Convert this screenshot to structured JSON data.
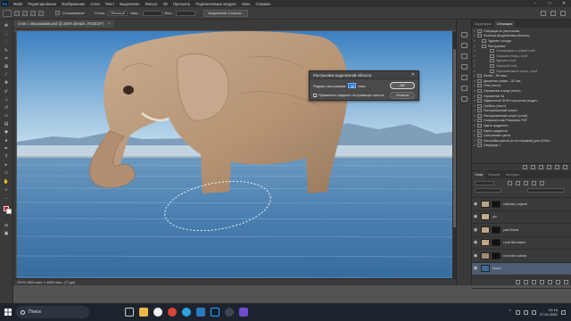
{
  "menubar": {
    "logo": "Ps",
    "items": [
      "Файл",
      "Редактирование",
      "Изображение",
      "Слои",
      "Текст",
      "Выделение",
      "Фильтр",
      "3D",
      "Просмотр",
      "Подключаемые модули",
      "Окно",
      "Справка"
    ],
    "window_controls": [
      "–",
      "□",
      "✕"
    ]
  },
  "options": {
    "smooth_label": "Сглаживание",
    "style_label": "Стиль:",
    "style_value": "Обычный",
    "width_label": "Шир.:",
    "height_label": "Выс.:",
    "refine_button": "Выделение и маска..."
  },
  "document": {
    "tab_title": "слон с пёрышками.psd @ 200% (beach, RGB/16*)",
    "tab_close": "×"
  },
  "status": {
    "text": "200%  1800 пикс. x 4656 пикс. (72 ppi)"
  },
  "dialog": {
    "title": "Растушевка выделенной области",
    "close": "✕",
    "radius_label": "Радиус растушевки:",
    "radius_value": "30",
    "unit": "пикс.",
    "checkbox_label": "Применить эффект на границах холста",
    "ok": "OK",
    "cancel": "Отмена"
  },
  "panels": {
    "top_tabs": [
      "Коррекция",
      "Операции"
    ],
    "history_items": [
      {
        "label": "Операции по умолчанию",
        "level": 0
      },
      {
        "label": "Фильтры (выделенная область)",
        "level": 0
      },
      {
        "label": "Удалить соседи",
        "level": 1
      },
      {
        "label": "Растушевка",
        "level": 1
      },
      {
        "label": "Скопировать в новый слой",
        "level": 2
      },
      {
        "label": "Показать текущ. слой",
        "level": 2
      },
      {
        "label": "Удалить слой",
        "level": 2
      },
      {
        "label": "Скрытый слой",
        "level": 2
      },
      {
        "label": "Переименовать текущ. слой",
        "level": 2
      },
      {
        "label": "Линия – 50 пикс.",
        "level": 0
      },
      {
        "label": "Движение рамки – 50 пик...",
        "level": 0
      },
      {
        "label": "Тень (текст)",
        "level": 0
      },
      {
        "label": "Отражение в воде (текст)",
        "level": 0
      },
      {
        "label": "Отражение 3d",
        "level": 0
      },
      {
        "label": "Эффектный ЭНФ в прошлом (выдел...",
        "level": 0
      },
      {
        "label": "Гребень (текст)",
        "level": 0
      },
      {
        "label": "Растушеванный силуэт",
        "level": 0
      },
      {
        "label": "Растушеванный силуэт (слой)",
        "level": 0
      },
      {
        "label": "Сохранить как Photoshop PDF",
        "level": 0
      },
      {
        "label": "Цвета градиента",
        "level": 0
      },
      {
        "label": "Карта градиента",
        "level": 0
      },
      {
        "label": "Смешанные цвета",
        "level": 0
      },
      {
        "label": "Настройки цветов (в гистограмме) для 16 бит...",
        "level": 0
      },
      {
        "label": "Операция 1",
        "level": 0
      }
    ],
    "layers_tabs": [
      "Слои",
      "Каналы",
      "Контуры"
    ],
    "layers": [
      {
        "name": "elephant_original",
        "visible": true,
        "selected": false,
        "thumb": "#b8a48a",
        "has_mask": true
      },
      {
        "name": "ухо",
        "visible": true,
        "selected": false,
        "thumb": "#c1ab8f",
        "has_mask": false
      },
      {
        "name": "уши боком",
        "visible": true,
        "selected": false,
        "thumb": "#bfa385",
        "has_mask": true
      },
      {
        "name": "слой без имени",
        "visible": true,
        "selected": false,
        "thumb": "#c2a587",
        "has_mask": true
      },
      {
        "name": "слон без хобота",
        "visible": true,
        "selected": false,
        "thumb": "#a68c73",
        "has_mask": true
      },
      {
        "name": "beach",
        "visible": true,
        "selected": true,
        "thumb": "#3f6c9a",
        "has_mask": false
      },
      {
        "name": "Фон",
        "visible": true,
        "selected": false,
        "thumb": "#dddddd",
        "has_mask": false
      }
    ]
  },
  "taskbar": {
    "search_label": "Поиск",
    "time": "21:16",
    "date": "27.01.2021"
  },
  "colors": {
    "accent": "#1e72d6",
    "foreground_swatch": "#d6141f",
    "background_swatch": "#ffffff"
  }
}
